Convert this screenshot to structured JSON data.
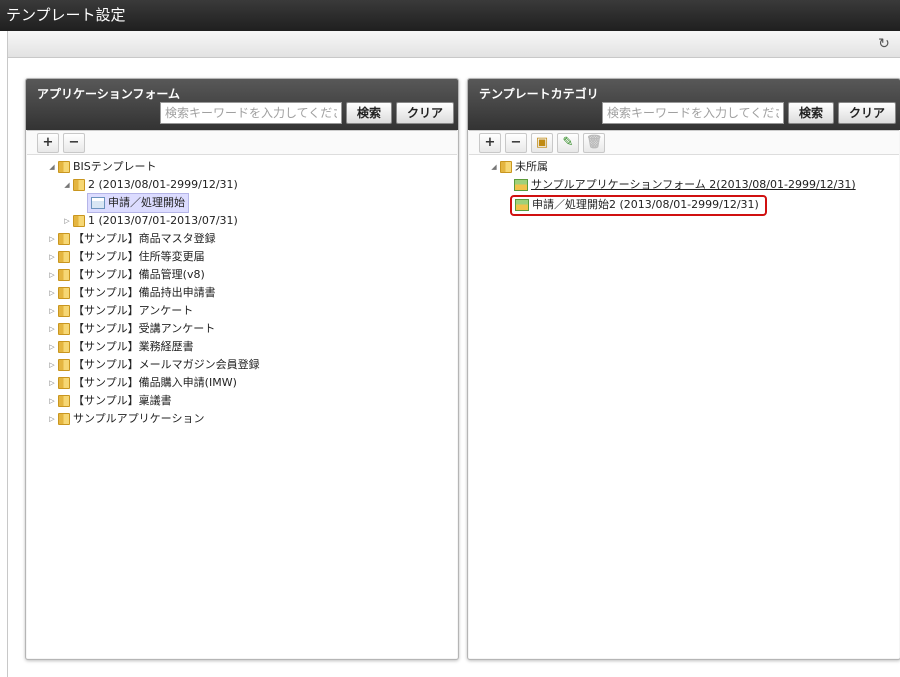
{
  "window": {
    "title": "テンプレート設定"
  },
  "toolbar": {
    "refresh_icon": "refresh-icon"
  },
  "left_panel": {
    "title": "アプリケーションフォーム",
    "search_placeholder": "検索キーワードを入力してください。",
    "search_label": "検索",
    "clear_label": "クリア",
    "tree": {
      "root": "BISテンプレート",
      "version2": "2 (2013/08/01-2999/12/31)",
      "form": "申請／処理開始",
      "version1": "1 (2013/07/01-2013/07/31)",
      "items": [
        "【サンプル】商品マスタ登録",
        "【サンプル】住所等変更届",
        "【サンプル】備品管理(v8)",
        "【サンプル】備品持出申請書",
        "【サンプル】アンケート",
        "【サンプル】受講アンケート",
        "【サンプル】業務経歴書",
        "【サンプル】メールマガジン会員登録",
        "【サンプル】備品購入申請(IMW)",
        "【サンプル】稟議書",
        "サンプルアプリケーション"
      ]
    }
  },
  "right_panel": {
    "title": "テンプレートカテゴリ",
    "search_placeholder": "検索キーワードを入力してください。",
    "search_label": "検索",
    "clear_label": "クリア",
    "tree": {
      "root": "未所属",
      "item1": "サンプルアプリケーションフォーム 2(2013/08/01-2999/12/31)",
      "item2": "申請／処理開始2 (2013/08/01-2999/12/31)"
    }
  }
}
